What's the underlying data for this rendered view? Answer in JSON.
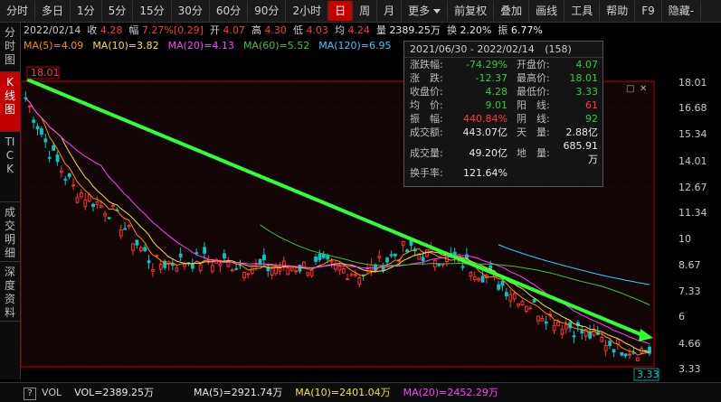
{
  "toolbar": {
    "items": [
      "分时",
      "多日",
      "1分",
      "5分",
      "15分",
      "30分",
      "60分",
      "90分",
      "2小时",
      "日",
      "周",
      "月",
      "更多",
      "前复权",
      "叠加",
      "画线",
      "工具",
      "帮助",
      "F9",
      "隐藏-"
    ],
    "active_index": 9,
    "dropdown_index": 12
  },
  "left_tabs": [
    {
      "label": "分时图",
      "active": false
    },
    {
      "label": "K线图",
      "active": true
    },
    {
      "label": "TICK",
      "active": false
    },
    {
      "label": "成交明细",
      "active": false
    },
    {
      "label": "深度资料",
      "active": false
    }
  ],
  "info_bar": {
    "date": "2022/02/14",
    "close_label": "收",
    "close": "4.28",
    "change_label": "幅",
    "change": "7.27%[0.29]",
    "open_label": "开",
    "open": "4.07",
    "high_label": "高",
    "high": "4.30",
    "low_label": "低",
    "low": "4.03",
    "avg_label": "均",
    "avg": "4.24",
    "volume_label": "量",
    "volume": "2389.25万",
    "turnover_label": "换",
    "turnover": "2.20%",
    "amplitude_label": "振",
    "amplitude": "6.77%"
  },
  "ma_bar": [
    {
      "label": "MA(5)=4.09",
      "color": "#ff8c00"
    },
    {
      "label": "MA(10)=3.82",
      "color": "#f0e040"
    },
    {
      "label": "MA(20)=4.13",
      "color": "#ff40ff"
    },
    {
      "label": "MA(60)=5.52",
      "color": "#40c040"
    },
    {
      "label": "MA(120)=6.95",
      "color": "#40c8ff"
    }
  ],
  "popup": {
    "range": "2021/06/30 - 2022/02/14",
    "count": "(158)",
    "rows": [
      {
        "l": "涨跌幅:",
        "v": "-74.29%",
        "vc": "green",
        "l2": "开盘价:",
        "v2": "4.07",
        "v2c": "green"
      },
      {
        "l": "涨　跌:",
        "v": "-12.37",
        "vc": "green",
        "l2": "最高价:",
        "v2": "18.01",
        "v2c": "green"
      },
      {
        "l": "收盘价:",
        "v": "4.28",
        "vc": "green",
        "l2": "最低价:",
        "v2": "3.33",
        "v2c": "green"
      },
      {
        "l": "均　价:",
        "v": "9.01",
        "vc": "green",
        "l2": "阳　线:",
        "v2": "61",
        "v2c": "red"
      },
      {
        "l": "振　幅:",
        "v": "440.84%",
        "vc": "red",
        "l2": "阴　线:",
        "v2": "92",
        "v2c": "green"
      },
      {
        "l": "成交额:",
        "v": "443.07亿",
        "vc": "white",
        "l2": "天　量:",
        "v2": "2.88亿",
        "v2c": "white"
      },
      {
        "l": "成交量:",
        "v": "49.20亿",
        "vc": "white",
        "l2": "地　量:",
        "v2": "685.91万",
        "v2c": "white"
      },
      {
        "l": "换手率:",
        "v": "121.64%",
        "vc": "white",
        "l2": "",
        "v2": "",
        "v2c": "white"
      }
    ]
  },
  "y_axis": [
    "18.01",
    "16.68",
    "15.34",
    "14.01",
    "12.67",
    "11.34",
    "10",
    "8.67",
    "7.33",
    "6",
    "4.66",
    "3.33"
  ],
  "high_marker": "18.01",
  "low_marker": "3.33",
  "vol_bar": {
    "help": "?",
    "vol": "VOL",
    "vol_value": "VOL=2389.25万",
    "ma5": "MA(5)=2921.74万",
    "ma10": "MA(10)=2401.04万",
    "ma20": "MA(20)=2452.29万"
  },
  "colors": {
    "up": "#ff3030",
    "down": "#00c8c8",
    "trend": "#30ff30",
    "frame": "#c00000"
  }
}
